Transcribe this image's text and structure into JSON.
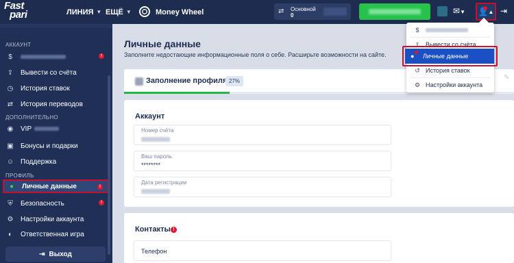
{
  "topbar": {
    "logo_line1": "Fast",
    "logo_line2": "pari",
    "nav_line": "ЛИНИЯ",
    "nav_more": "ЕЩЁ",
    "money_wheel": "Money Wheel",
    "balance_label": "Основной",
    "balance_value": "0"
  },
  "sidebar": {
    "section_account": "АККАУНТ",
    "items_account": [
      {
        "label": "Вывести со счёта",
        "icon": "upload-icon"
      },
      {
        "label": "История ставок",
        "icon": "clock-icon"
      },
      {
        "label": "История переводов",
        "icon": "transfer-icon"
      }
    ],
    "section_extra": "ДОПОЛНИТЕЛЬНО",
    "vip_label": "VIP",
    "items_extra": [
      {
        "label": "Бонусы и подарки",
        "icon": "gift-icon"
      },
      {
        "label": "Поддержка",
        "icon": "support-icon"
      }
    ],
    "section_profile": "ПРОФИЛЬ",
    "personal_data": "Личные данные",
    "items_profile": [
      {
        "label": "Безопасность",
        "icon": "shield-icon"
      },
      {
        "label": "Настройки аккаунта",
        "icon": "gear-icon"
      },
      {
        "label": "Ответственная игра",
        "icon": "shield-half-icon"
      }
    ],
    "logout": "Выход"
  },
  "main": {
    "title": "Личные данные",
    "subtitle": "Заполните недостающие информационные поля о себе. Расширьте возможности на сайте.",
    "progress": {
      "title": "Заполнение профиля",
      "percent_label": "27%",
      "percent": 27
    },
    "account": {
      "title": "Аккаунт",
      "account_number_label": "Номер счёта",
      "password_label": "Ваш пароль",
      "password_value": "********",
      "registration_date_label": "Дата регистрации"
    },
    "contacts": {
      "title": "Контакты",
      "phone_label": "Телефон"
    }
  },
  "dropdown": {
    "items": [
      {
        "label": "Вывести со счёта",
        "icon": "upload-icon"
      },
      {
        "label": "Личные данные",
        "icon": "user-icon",
        "active": true
      },
      {
        "label": "История ставок",
        "icon": "history-icon"
      },
      {
        "label": "Настройки аккаунта",
        "icon": "gear-icon"
      }
    ]
  },
  "colors": {
    "topbar": "#1d2c4f",
    "sidebar": "#1f2f56",
    "accent_green": "#27c24c",
    "highlight_red": "#c8102e",
    "active_blue": "#1b4fc4"
  }
}
